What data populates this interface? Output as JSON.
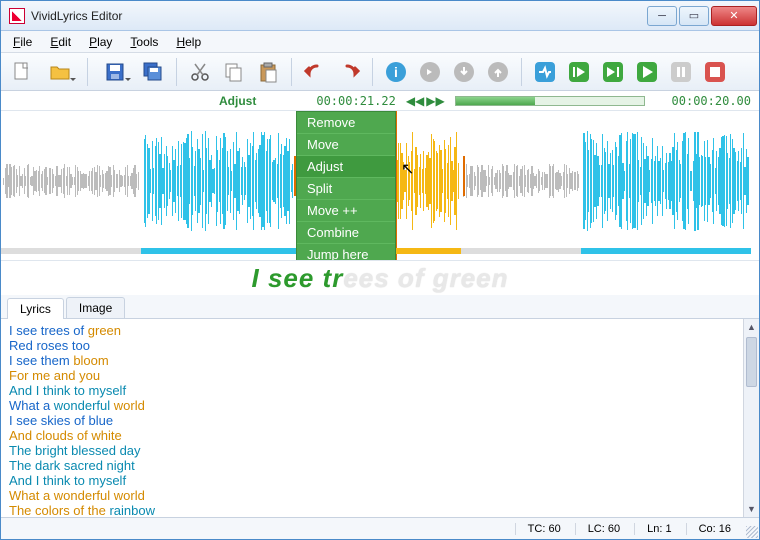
{
  "window": {
    "title": "VividLyrics Editor"
  },
  "menu": {
    "file": "File",
    "edit": "Edit",
    "play": "Play",
    "tools": "Tools",
    "help": "Help"
  },
  "timebar": {
    "mode": "Adjust",
    "now": "00:00:21.22",
    "total": "00:00:20.00"
  },
  "context_menu": {
    "items": [
      "Remove",
      "Move",
      "Adjust",
      "Split",
      "Move ++",
      "Combine",
      "Jump here"
    ],
    "selected_index": 2
  },
  "preview": {
    "sung": "I see tr",
    "unsung": "ees of green"
  },
  "tabs": {
    "lyrics": "Lyrics",
    "image": "Image"
  },
  "lyrics": [
    [
      [
        "blue",
        "I see trees of "
      ],
      [
        "amber",
        "green"
      ]
    ],
    [
      [
        "blue",
        "Red roses too"
      ]
    ],
    [
      [
        "blue",
        "I see them "
      ],
      [
        "amber",
        "bloom"
      ]
    ],
    [
      [
        "amber",
        "For me and you"
      ]
    ],
    [
      [
        "cyan",
        "And I think to myself"
      ]
    ],
    [
      [
        "blue",
        "What a "
      ],
      [
        "cyan",
        "wonderful "
      ],
      [
        "amber",
        "world"
      ]
    ],
    [
      [
        "blue",
        "I see skies of blue"
      ]
    ],
    [
      [
        "amber",
        "And clouds of white"
      ]
    ],
    [
      [
        "cyan",
        "The bright blessed day"
      ]
    ],
    [
      [
        "cyan",
        "The dark sacred night"
      ]
    ],
    [
      [
        "cyan",
        "And I think to myself"
      ]
    ],
    [
      [
        "amber",
        "What a wonderful world"
      ]
    ],
    [
      [
        "amber",
        "The colors of the "
      ],
      [
        "cyan",
        "rainbow"
      ]
    ]
  ],
  "status": {
    "tc": "TC: 60",
    "lc": "LC: 60",
    "ln": "Ln: 1",
    "co": "Co: 16"
  },
  "colors": {
    "green": "#2f8c3d",
    "cyan": "#2fc2e8",
    "amber": "#f5b814",
    "gray": "#bcbcbc"
  }
}
